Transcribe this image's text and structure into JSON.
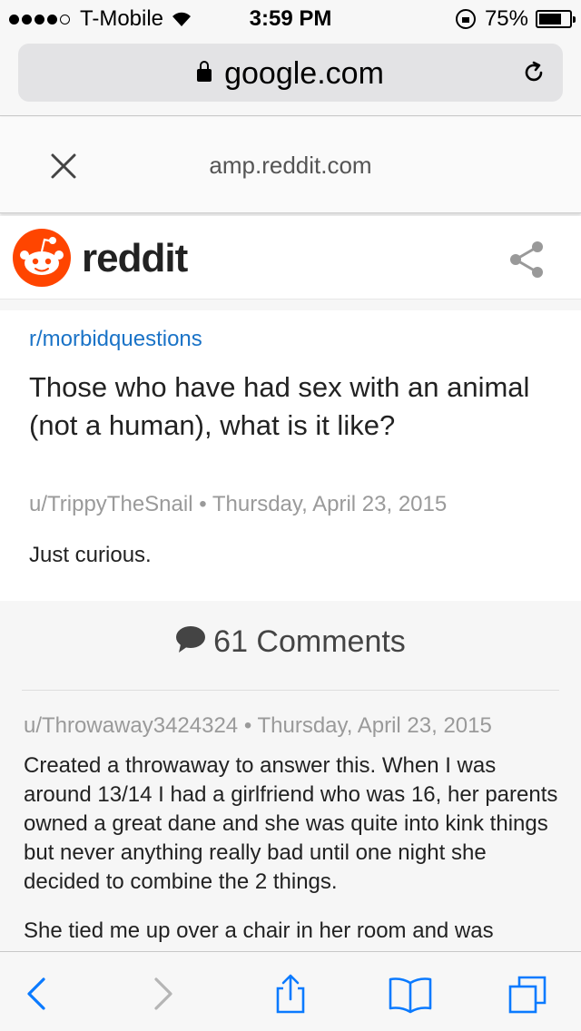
{
  "status_bar": {
    "carrier": "T-Mobile",
    "time": "3:59 PM",
    "battery": "75%",
    "battery_level": 0.75,
    "signal_bars": 4
  },
  "url_bar": {
    "url": "google.com"
  },
  "amp_header": {
    "domain": "amp.reddit.com"
  },
  "reddit_header": {
    "wordmark": "reddit",
    "brand_color": "#ff4500"
  },
  "post": {
    "subreddit": "r/morbidquestions",
    "title": "Those who have had sex with an animal (not a human), what is it like?",
    "author": "u/TrippyTheSnail",
    "separator": "•",
    "date": "Thursday, April 23, 2015",
    "body": "Just curious."
  },
  "comments": {
    "count_label": "61 Comments",
    "first": {
      "author": "u/Throwaway3424324",
      "separator": "•",
      "date": "Thursday, April 23, 2015",
      "paragraph_1": "Created a throwaway to answer this. When I was around 13/14 I had a girlfriend who was 16, her parents owned a great dane and she was quite into kink things but never anything really bad until one night she decided to combine the 2 things.",
      "paragraph_2": "She tied me up over a chair in her room and was"
    }
  },
  "colors": {
    "link": "#1a73c7",
    "ios_blue": "#0a7aff",
    "muted": "#9a9a9a"
  },
  "toolbar": {
    "icons": [
      "back-icon",
      "forward-icon",
      "share-icon",
      "bookmarks-icon",
      "tabs-icon"
    ]
  }
}
